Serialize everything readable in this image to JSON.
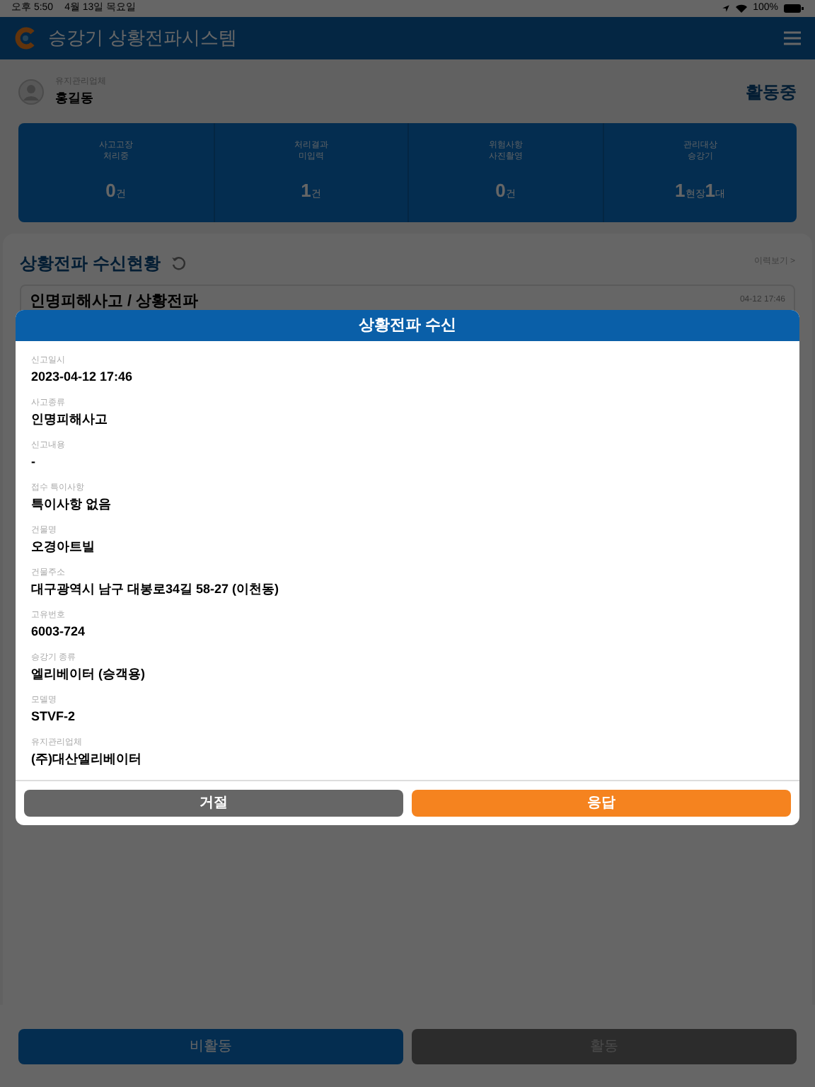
{
  "status_bar": {
    "time": "오후 5:50",
    "date": "4월 13일 목요일",
    "battery": "100%"
  },
  "header": {
    "title": "승강기 상황전파시스템"
  },
  "user": {
    "role": "유지관리업체",
    "name": "홍길동",
    "status": "활동중"
  },
  "stats": [
    {
      "label": "사고고장 처리중",
      "parts": [
        {
          "value": "0",
          "unit": "건"
        }
      ]
    },
    {
      "label": "처리결과 미입력",
      "parts": [
        {
          "value": "1",
          "unit": "건"
        }
      ]
    },
    {
      "label": "위험사항 사진촬영",
      "parts": [
        {
          "value": "0",
          "unit": "건"
        }
      ]
    },
    {
      "label": "관리대상 승강기",
      "parts": [
        {
          "value": "1",
          "unit": "현장"
        },
        {
          "value": "1",
          "unit": "대"
        }
      ]
    }
  ],
  "feed": {
    "title": "상황전파 수신현황",
    "history_link": "이력보기 >",
    "items": [
      {
        "title": "인명피해사고 / 상황전파",
        "time": "04-12 17:46"
      }
    ]
  },
  "modal": {
    "title": "상황전파 수신",
    "fields": [
      {
        "label": "신고일시",
        "value": "2023-04-12 17:46"
      },
      {
        "label": "사고종류",
        "value": "인명피해사고"
      },
      {
        "label": "신고내용",
        "value": "-"
      },
      {
        "label": "접수 특이사항",
        "value": "특이사항 없음"
      },
      {
        "label": "건물명",
        "value": "오경아트빌"
      },
      {
        "label": "건물주소",
        "value": "대구광역시 남구 대봉로34길 58-27 (이천동)"
      },
      {
        "label": "고유번호",
        "value": "6003-724"
      },
      {
        "label": "승강기 종류",
        "value": "엘리베이터 (승객용)"
      },
      {
        "label": "모델명",
        "value": "STVF-2"
      },
      {
        "label": "유지관리업체",
        "value": "(주)대산엘리베이터"
      }
    ],
    "buttons": [
      {
        "label": "거절",
        "kind": "reject"
      },
      {
        "label": "응답",
        "kind": "accept"
      }
    ]
  },
  "bottom_buttons": [
    {
      "label": "비활동",
      "selected": true
    },
    {
      "label": "활동",
      "selected": false
    }
  ]
}
